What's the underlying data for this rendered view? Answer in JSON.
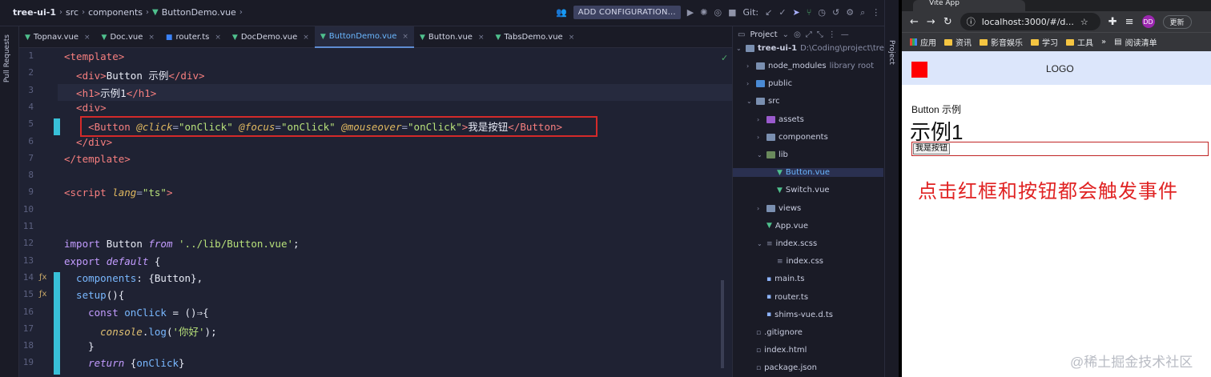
{
  "ide": {
    "breadcrumb": [
      "tree-ui-1",
      "src",
      "components",
      "ButtonDemo.vue"
    ],
    "add_configuration": "ADD CONFIGURATION...",
    "git_label": "Git:",
    "pull_requests": "Pull Requests",
    "tabs": [
      {
        "label": "Topnav.vue",
        "type": "vue"
      },
      {
        "label": "Doc.vue",
        "type": "vue"
      },
      {
        "label": "router.ts",
        "type": "ts"
      },
      {
        "label": "DocDemo.vue",
        "type": "vue"
      },
      {
        "label": "ButtonDemo.vue",
        "type": "vue",
        "active": true
      },
      {
        "label": "Button.vue",
        "type": "vue"
      },
      {
        "label": "TabsDemo.vue",
        "type": "vue"
      }
    ],
    "line_numbers": [
      "1",
      "2",
      "3",
      "4",
      "5",
      "6",
      "7",
      "8",
      "9",
      "10",
      "11",
      "12",
      "13",
      "14",
      "15",
      "16",
      "17",
      "18",
      "19"
    ],
    "code_lines": [
      [
        [
          "t",
          "<template>"
        ]
      ],
      [
        [
          "t",
          "  <div>"
        ],
        [
          "w",
          "Button 示例"
        ],
        [
          "t",
          "</div>"
        ]
      ],
      [
        [
          "t",
          "  <h1>"
        ],
        [
          "w",
          "示例1"
        ],
        [
          "t",
          "</h1>"
        ]
      ],
      [
        [
          "t",
          "  <div>"
        ]
      ],
      [
        [
          "t",
          "    <Button "
        ],
        [
          "a",
          "@click"
        ],
        [
          "br",
          "="
        ],
        [
          "s",
          "\"onClick\" "
        ],
        [
          "a",
          "@focus"
        ],
        [
          "br",
          "="
        ],
        [
          "s",
          "\"onClick\" "
        ],
        [
          "a",
          "@mouseover"
        ],
        [
          "br",
          "="
        ],
        [
          "s",
          "\"onClick\""
        ],
        [
          "t",
          ">"
        ],
        [
          "w",
          "我是按钮"
        ],
        [
          "t",
          "</Button>"
        ]
      ],
      [
        [
          "t",
          "  </div>"
        ]
      ],
      [
        [
          "t",
          "</template>"
        ]
      ],
      [],
      [
        [
          "t",
          "<script "
        ],
        [
          "a",
          "lang"
        ],
        [
          "br",
          "="
        ],
        [
          "s",
          "\"ts\""
        ],
        [
          "t",
          ">"
        ]
      ],
      [],
      [],
      [
        [
          "kw",
          "import "
        ],
        [
          "w",
          "Button "
        ],
        [
          "k",
          "from "
        ],
        [
          "s",
          "'../lib/Button.vue'"
        ],
        [
          "w",
          ";"
        ]
      ],
      [
        [
          "kw",
          "export "
        ],
        [
          "k",
          "default "
        ],
        [
          "w",
          "{"
        ]
      ],
      [
        [
          "f",
          "  components"
        ],
        [
          "w",
          ": {Button},"
        ]
      ],
      [
        [
          "f",
          "  setup"
        ],
        [
          "w",
          "(){"
        ]
      ],
      [
        [
          "kw",
          "    const "
        ],
        [
          "f",
          "onClick "
        ],
        [
          "w",
          "= ()⇒{"
        ]
      ],
      [
        [
          "fn",
          "      console"
        ],
        [
          "w",
          "."
        ],
        [
          "f",
          "log"
        ],
        [
          "w",
          "("
        ],
        [
          "s",
          "'你好'"
        ],
        [
          "w",
          ");"
        ]
      ],
      [
        [
          "w",
          "    }"
        ]
      ],
      [
        [
          "k",
          "    return "
        ],
        [
          "w",
          "{"
        ],
        [
          "f",
          "onClick"
        ],
        [
          "w",
          "}"
        ]
      ]
    ],
    "project_panel": {
      "header": "Project",
      "root": "tree-ui-1",
      "root_path": "D:\\Coding\\project\\tree-",
      "tree": [
        {
          "label": "node_modules",
          "suffix": "library root",
          "depth": 1,
          "arrow": "›",
          "kind": "folder"
        },
        {
          "label": "public",
          "depth": 1,
          "arrow": "›",
          "kind": "folder-b"
        },
        {
          "label": "src",
          "depth": 1,
          "arrow": "⌄",
          "kind": "folder"
        },
        {
          "label": "assets",
          "depth": 2,
          "arrow": "›",
          "kind": "folder-pu"
        },
        {
          "label": "components",
          "depth": 2,
          "arrow": "›",
          "kind": "folder"
        },
        {
          "label": "lib",
          "depth": 2,
          "arrow": "⌄",
          "kind": "folder-g"
        },
        {
          "label": "Button.vue",
          "depth": 3,
          "arrow": "",
          "kind": "vue",
          "selected": true
        },
        {
          "label": "Switch.vue",
          "depth": 3,
          "arrow": "",
          "kind": "vue"
        },
        {
          "label": "views",
          "depth": 2,
          "arrow": "›",
          "kind": "folder"
        },
        {
          "label": "App.vue",
          "depth": 2,
          "arrow": "",
          "kind": "vue"
        },
        {
          "label": "index.scss",
          "depth": 2,
          "arrow": "⌄",
          "kind": "style"
        },
        {
          "label": "index.css",
          "depth": 3,
          "arrow": "",
          "kind": "style"
        },
        {
          "label": "main.ts",
          "depth": 2,
          "arrow": "",
          "kind": "ts"
        },
        {
          "label": "router.ts",
          "depth": 2,
          "arrow": "",
          "kind": "ts"
        },
        {
          "label": "shims-vue.d.ts",
          "depth": 2,
          "arrow": "",
          "kind": "ts"
        },
        {
          "label": ".gitignore",
          "depth": 1,
          "arrow": "",
          "kind": "file"
        },
        {
          "label": "index.html",
          "depth": 1,
          "arrow": "",
          "kind": "file"
        },
        {
          "label": "package.json",
          "depth": 1,
          "arrow": "",
          "kind": "file"
        }
      ]
    },
    "side_project_label": "Project"
  },
  "browser": {
    "tab_title": "Vite App",
    "url": "localhost:3000/#/d...",
    "profile": "DD",
    "update_label": "更新",
    "bookmarks": [
      "应用",
      "资讯",
      "影音娱乐",
      "学习",
      "工具"
    ],
    "reading_list": "阅读清单",
    "page": {
      "logo": "LOGO",
      "paragraph": "Button 示例",
      "heading": "示例1",
      "button": "我是按钮",
      "note": "点击红框和按钮都会触发事件"
    },
    "watermark": "@稀土掘金技术社区"
  },
  "colors": {
    "highlight_box": "#d42a2a",
    "note_text": "#e02222",
    "navbar_bg": "#dce6fb",
    "logo_square": "#ff0000"
  }
}
